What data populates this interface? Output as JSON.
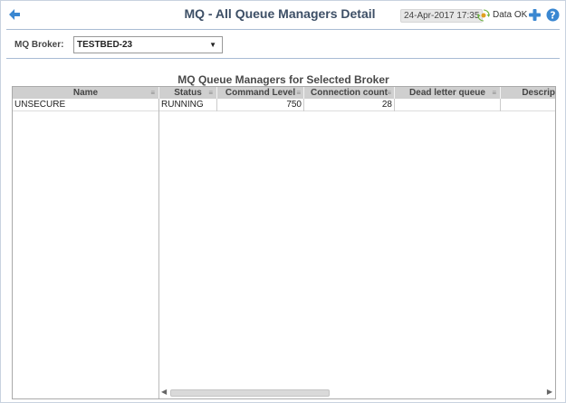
{
  "header": {
    "title": "MQ - All Queue Managers Detail",
    "timestamp": "24-Apr-2017 17:35",
    "data_status": "Data OK",
    "icons": {
      "back": "back-arrow-icon",
      "refresh": "refresh-icon",
      "add": "plus-icon",
      "help": "help-icon"
    },
    "colors": {
      "back_arrow": "#3a87d1",
      "refresh": "#4caf50",
      "plus": "#3a87d1",
      "help": "#3a87d1"
    }
  },
  "filter": {
    "broker_label": "MQ Broker:",
    "broker_value": "TESTBED-23"
  },
  "table": {
    "title": "MQ Queue Managers for Selected Broker",
    "columns": [
      "Name",
      "Status",
      "Command Level",
      "Connection count",
      "Dead letter queue",
      "Descrip"
    ],
    "rows": [
      {
        "name": "UNSECURE",
        "status": "RUNNING",
        "command_level": "750",
        "connection_count": "28",
        "dead_letter_queue": "",
        "description": ""
      }
    ]
  }
}
